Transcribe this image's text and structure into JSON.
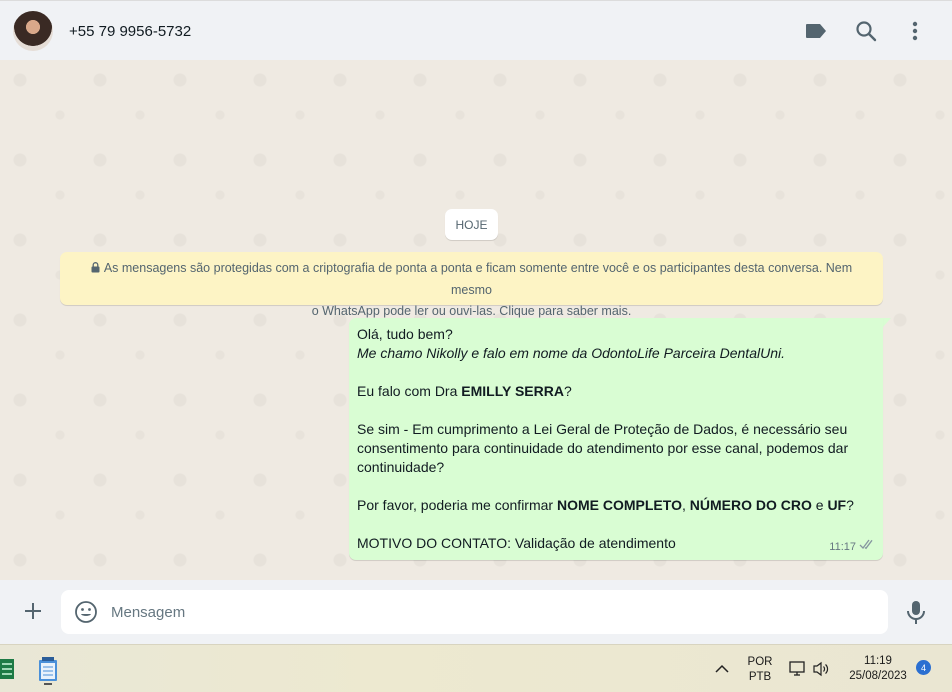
{
  "header": {
    "contact_name": "+55 79 9956-5732",
    "icons": [
      "label-icon",
      "search-icon",
      "menu-dots-icon"
    ]
  },
  "chat": {
    "date_chip": "HOJE",
    "encryption_notice": {
      "line1": "As mensagens são protegidas com a criptografia de ponta a ponta e ficam somente entre você e os participantes desta conversa. Nem mesmo",
      "line2": "o WhatsApp pode ler ou ouvi-las. Clique para saber mais."
    },
    "message": {
      "greeting": "Olá, tudo bem?",
      "intro": "Me chamo Nikolly e falo em nome da OdontoLife Parceira DentalUni.",
      "question_prefix": "Eu falo com Dra ",
      "question_name": "EMILLY SERRA",
      "question_suffix": "?",
      "lgpd_line1": "Se sim - Em cumprimento a Lei Geral de Proteção de Dados, é necessário seu",
      "lgpd_line2": "consentimento para continuidade do atendimento por esse canal, podemos dar",
      "lgpd_line3": "continuidade?",
      "confirm_prefix": "Por favor, poderia me confirmar ",
      "confirm_field1": "NOME COMPLETO",
      "confirm_sep1": ", ",
      "confirm_field2": "NÚMERO DO CRO",
      "confirm_sep2": " e ",
      "confirm_field3": "UF",
      "confirm_suffix": "?",
      "reason": "MOTIVO DO CONTATO: Validação de atendimento",
      "time": "11:17",
      "status": "read"
    }
  },
  "composer": {
    "placeholder": "Mensagem"
  },
  "taskbar": {
    "language_line1": "POR",
    "language_line2": "PTB",
    "time": "11:19",
    "date": "25/08/2023",
    "notification_count": "4"
  },
  "colors": {
    "outgoing_bubble": "#d9fdd3",
    "notice_bg": "#fdf4c5",
    "chat_bg": "#efeae2",
    "header_bg": "#f0f2f5",
    "read_tick": "#8696a0"
  }
}
